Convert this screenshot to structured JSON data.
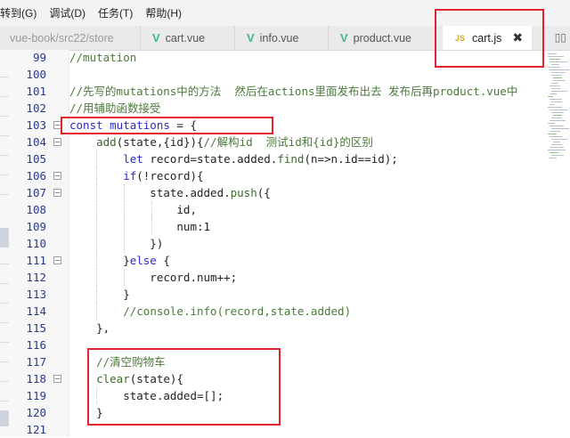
{
  "menubar": {
    "items": [
      "转到(G)",
      "调试(D)",
      "任务(T)",
      "帮助(H)"
    ]
  },
  "tabbar": {
    "path": "vue-book/src22/store",
    "tabs": [
      {
        "label": "cart.vue",
        "icon": "vue-icon"
      },
      {
        "label": "info.vue",
        "icon": "vue-icon"
      },
      {
        "label": "product.vue",
        "icon": "vue-icon"
      }
    ],
    "active_tab": {
      "label": "cart.js",
      "icon_text": "JS",
      "close": "✖"
    }
  },
  "editor": {
    "lines": [
      {
        "n": "99",
        "parts": [
          [
            "c",
            "//mutation"
          ]
        ]
      },
      {
        "n": "100",
        "parts": []
      },
      {
        "n": "101",
        "parts": [
          [
            "c",
            "//先写的mutations中的方法  然后在actions里面发布出去 发布后再product.vue中"
          ]
        ]
      },
      {
        "n": "102",
        "parts": [
          [
            "c",
            "//用辅助函数接受"
          ]
        ]
      },
      {
        "n": "103",
        "fold": "−",
        "parts": [
          [
            "k",
            "const "
          ],
          [
            "v",
            "mutations"
          ],
          [
            "o",
            " = {"
          ]
        ]
      },
      {
        "n": "104",
        "fold": "−",
        "parts": [
          [
            "o",
            "    "
          ],
          [
            "f",
            "add"
          ],
          [
            "o",
            "(state,{id}){"
          ],
          [
            "c",
            "//解构id  测试id和{id}的区别"
          ]
        ]
      },
      {
        "n": "105",
        "parts": [
          [
            "o",
            "        "
          ],
          [
            "k",
            "let "
          ],
          [
            "o",
            "record=state.added."
          ],
          [
            "f",
            "find"
          ],
          [
            "o",
            "(n=>n.id==id);"
          ]
        ]
      },
      {
        "n": "106",
        "fold": "−",
        "parts": [
          [
            "o",
            "        "
          ],
          [
            "k",
            "if"
          ],
          [
            "o",
            "(!record){"
          ]
        ]
      },
      {
        "n": "107",
        "fold": "−",
        "parts": [
          [
            "o",
            "            state.added."
          ],
          [
            "f",
            "push"
          ],
          [
            "o",
            "({"
          ]
        ]
      },
      {
        "n": "108",
        "parts": [
          [
            "o",
            "                id,"
          ]
        ]
      },
      {
        "n": "109",
        "parts": [
          [
            "o",
            "                num:"
          ],
          [
            "n",
            "1"
          ]
        ]
      },
      {
        "n": "110",
        "parts": [
          [
            "o",
            "            })"
          ]
        ]
      },
      {
        "n": "111",
        "fold": "−",
        "parts": [
          [
            "o",
            "        }"
          ],
          [
            "k",
            "else "
          ],
          [
            "o",
            "{"
          ]
        ]
      },
      {
        "n": "112",
        "parts": [
          [
            "o",
            "            record.num++;"
          ]
        ]
      },
      {
        "n": "113",
        "parts": [
          [
            "o",
            "        }"
          ]
        ]
      },
      {
        "n": "114",
        "parts": [
          [
            "o",
            "        "
          ],
          [
            "c",
            "//console.info(record,state.added)"
          ]
        ]
      },
      {
        "n": "115",
        "parts": [
          [
            "o",
            "    },"
          ]
        ]
      },
      {
        "n": "116",
        "parts": []
      },
      {
        "n": "117",
        "parts": [
          [
            "o",
            "    "
          ],
          [
            "c",
            "//清空购物车"
          ]
        ]
      },
      {
        "n": "118",
        "fold": "−",
        "parts": [
          [
            "o",
            "    "
          ],
          [
            "f",
            "clear"
          ],
          [
            "o",
            "(state){"
          ]
        ]
      },
      {
        "n": "119",
        "parts": [
          [
            "o",
            "        state.added=[];"
          ]
        ]
      },
      {
        "n": "120",
        "parts": [
          [
            "o",
            "    }"
          ]
        ]
      },
      {
        "n": "121",
        "parts": []
      }
    ]
  },
  "colors": {
    "highlight_box": "#e0232d",
    "vue_icon": "#41b883",
    "js_icon": "#d7a82c",
    "keyword": "#2a2ac8",
    "comment": "#4a7a3a"
  }
}
